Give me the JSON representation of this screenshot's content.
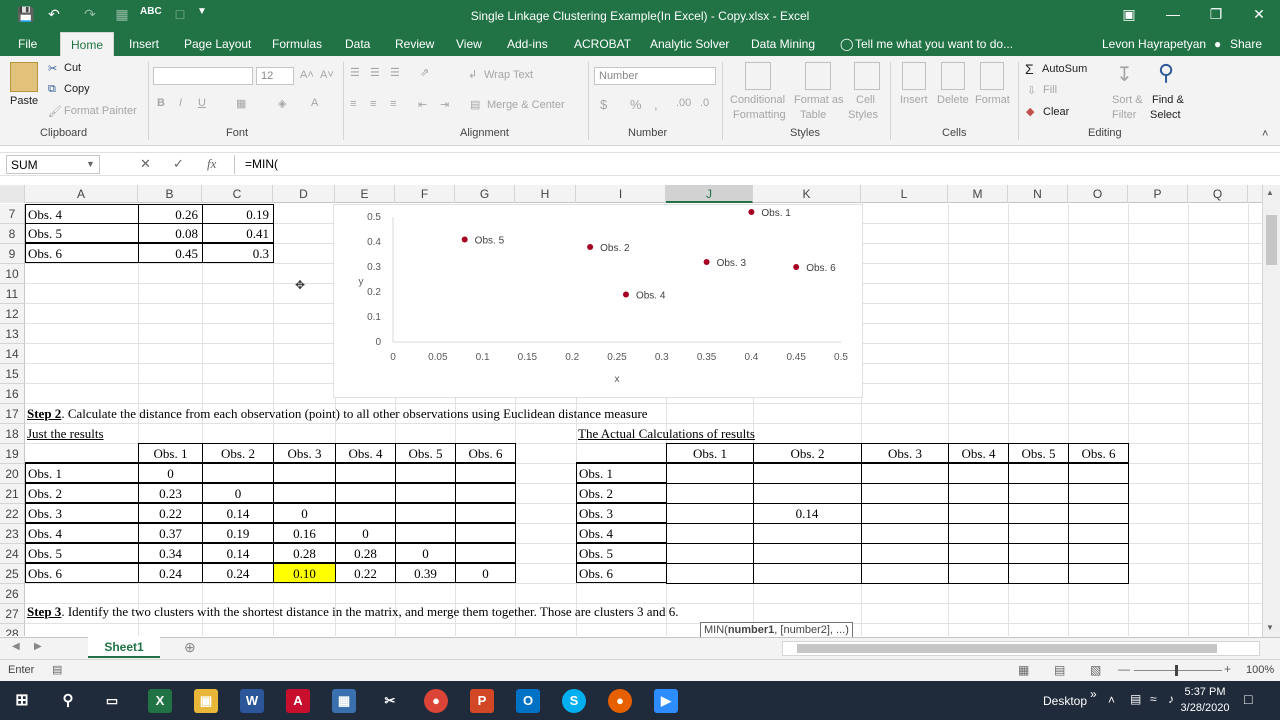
{
  "app": {
    "title": "Single Linkage Clustering Example(In Excel) - Copy.xlsx - Excel",
    "user": "Levon Hayrapetyan",
    "share": "Share"
  },
  "tabs": [
    "File",
    "Home",
    "Insert",
    "Page Layout",
    "Formulas",
    "Data",
    "Review",
    "View",
    "Add-ins",
    "ACROBAT",
    "Analytic Solver",
    "Data Mining"
  ],
  "tell_me": "Tell me what you want to do...",
  "ribbon": {
    "clipboard": {
      "paste": "Paste",
      "cut": "Cut",
      "copy": "Copy",
      "format_painter": "Format Painter",
      "label": "Clipboard"
    },
    "font": {
      "size": "12",
      "label": "Font"
    },
    "alignment": {
      "wrap": "Wrap Text",
      "merge": "Merge & Center",
      "label": "Alignment"
    },
    "number": {
      "format": "Number",
      "label": "Number"
    },
    "styles": {
      "cond": "Conditional",
      "cond2": "Formatting",
      "format_as": "Format as",
      "table": "Table",
      "cell": "Cell",
      "cell2": "Styles",
      "label": "Styles"
    },
    "cells": {
      "insert": "Insert",
      "delete": "Delete",
      "format": "Format",
      "label": "Cells"
    },
    "editing": {
      "autosum": "AutoSum",
      "fill": "Fill",
      "clear": "Clear",
      "sort": "Sort &",
      "filter": "Filter",
      "find": "Find &",
      "select": "Select",
      "label": "Editing"
    }
  },
  "formula_bar": {
    "namebox": "SUM",
    "formula": "=MIN("
  },
  "columns": [
    "A",
    "B",
    "C",
    "D",
    "E",
    "F",
    "G",
    "H",
    "I",
    "J",
    "K",
    "L",
    "M",
    "N",
    "O",
    "P",
    "Q"
  ],
  "rows": [
    "7",
    "8",
    "9",
    "10",
    "11",
    "12",
    "13",
    "14",
    "15",
    "16",
    "17",
    "18",
    "19",
    "20",
    "21",
    "22",
    "23",
    "24",
    "25",
    "26",
    "27",
    "28"
  ],
  "top_table": [
    [
      "Obs. 4",
      "0.26",
      "0.19"
    ],
    [
      "Obs. 5",
      "0.08",
      "0.41"
    ],
    [
      "Obs. 6",
      "0.45",
      "0.3"
    ]
  ],
  "step2": {
    "bold": "Step 2",
    "text": ". Calculate the distance from each observation (point) to all other observations using Euclidean distance measure"
  },
  "just_results": "Just the results",
  "actual_calc": "The Actual Calculations of results",
  "obs_headers": [
    "Obs. 1",
    "Obs. 2",
    "Obs. 3",
    "Obs. 4",
    "Obs. 5",
    "Obs. 6"
  ],
  "matrix": [
    [
      "0",
      "",
      "",
      "",
      "",
      ""
    ],
    [
      "0.23",
      "0",
      "",
      "",
      "",
      ""
    ],
    [
      "0.22",
      "0.14",
      "0",
      "",
      "",
      ""
    ],
    [
      "0.37",
      "0.19",
      "0.16",
      "0",
      "",
      ""
    ],
    [
      "0.34",
      "0.14",
      "0.28",
      "0.28",
      "0",
      ""
    ],
    [
      "0.24",
      "0.24",
      "0.10",
      "0.22",
      "0.39",
      "0"
    ]
  ],
  "actual_value": "0.14",
  "step3": {
    "bold": "Step 3",
    "text": ". Identify the two clusters with the shortest distance in the matrix, and merge them together. Those are clusters 3 and 6."
  },
  "tooltip": {
    "fn": "MIN(",
    "bold": "number1",
    "rest": ", [number2], ...)"
  },
  "sheet_tab": "Sheet1",
  "status": "Enter",
  "zoom": "100%",
  "taskbar": {
    "desktop": "Desktop",
    "time": "5:37 PM",
    "date": "3/28/2020"
  },
  "chart_data": {
    "type": "scatter",
    "xlabel": "x",
    "ylabel": "y",
    "xlim": [
      0,
      0.5
    ],
    "ylim": [
      0,
      0.5
    ],
    "xticks": [
      "0",
      "0.05",
      "0.1",
      "0.15",
      "0.2",
      "0.25",
      "0.3",
      "0.35",
      "0.4",
      "0.45",
      "0.5"
    ],
    "yticks": [
      "0",
      "0.1",
      "0.2",
      "0.3",
      "0.4",
      "0.5"
    ],
    "points": [
      {
        "label": "Obs. 1",
        "x": 0.4,
        "y": 0.52
      },
      {
        "label": "Obs. 2",
        "x": 0.22,
        "y": 0.38
      },
      {
        "label": "Obs. 3",
        "x": 0.35,
        "y": 0.32
      },
      {
        "label": "Obs. 4",
        "x": 0.26,
        "y": 0.19
      },
      {
        "label": "Obs. 5",
        "x": 0.08,
        "y": 0.41
      },
      {
        "label": "Obs. 6",
        "x": 0.45,
        "y": 0.3
      }
    ],
    "marker_color": "#a50021"
  },
  "colors": {
    "excel_green": "#217346",
    "highlight": "#ffff00"
  }
}
